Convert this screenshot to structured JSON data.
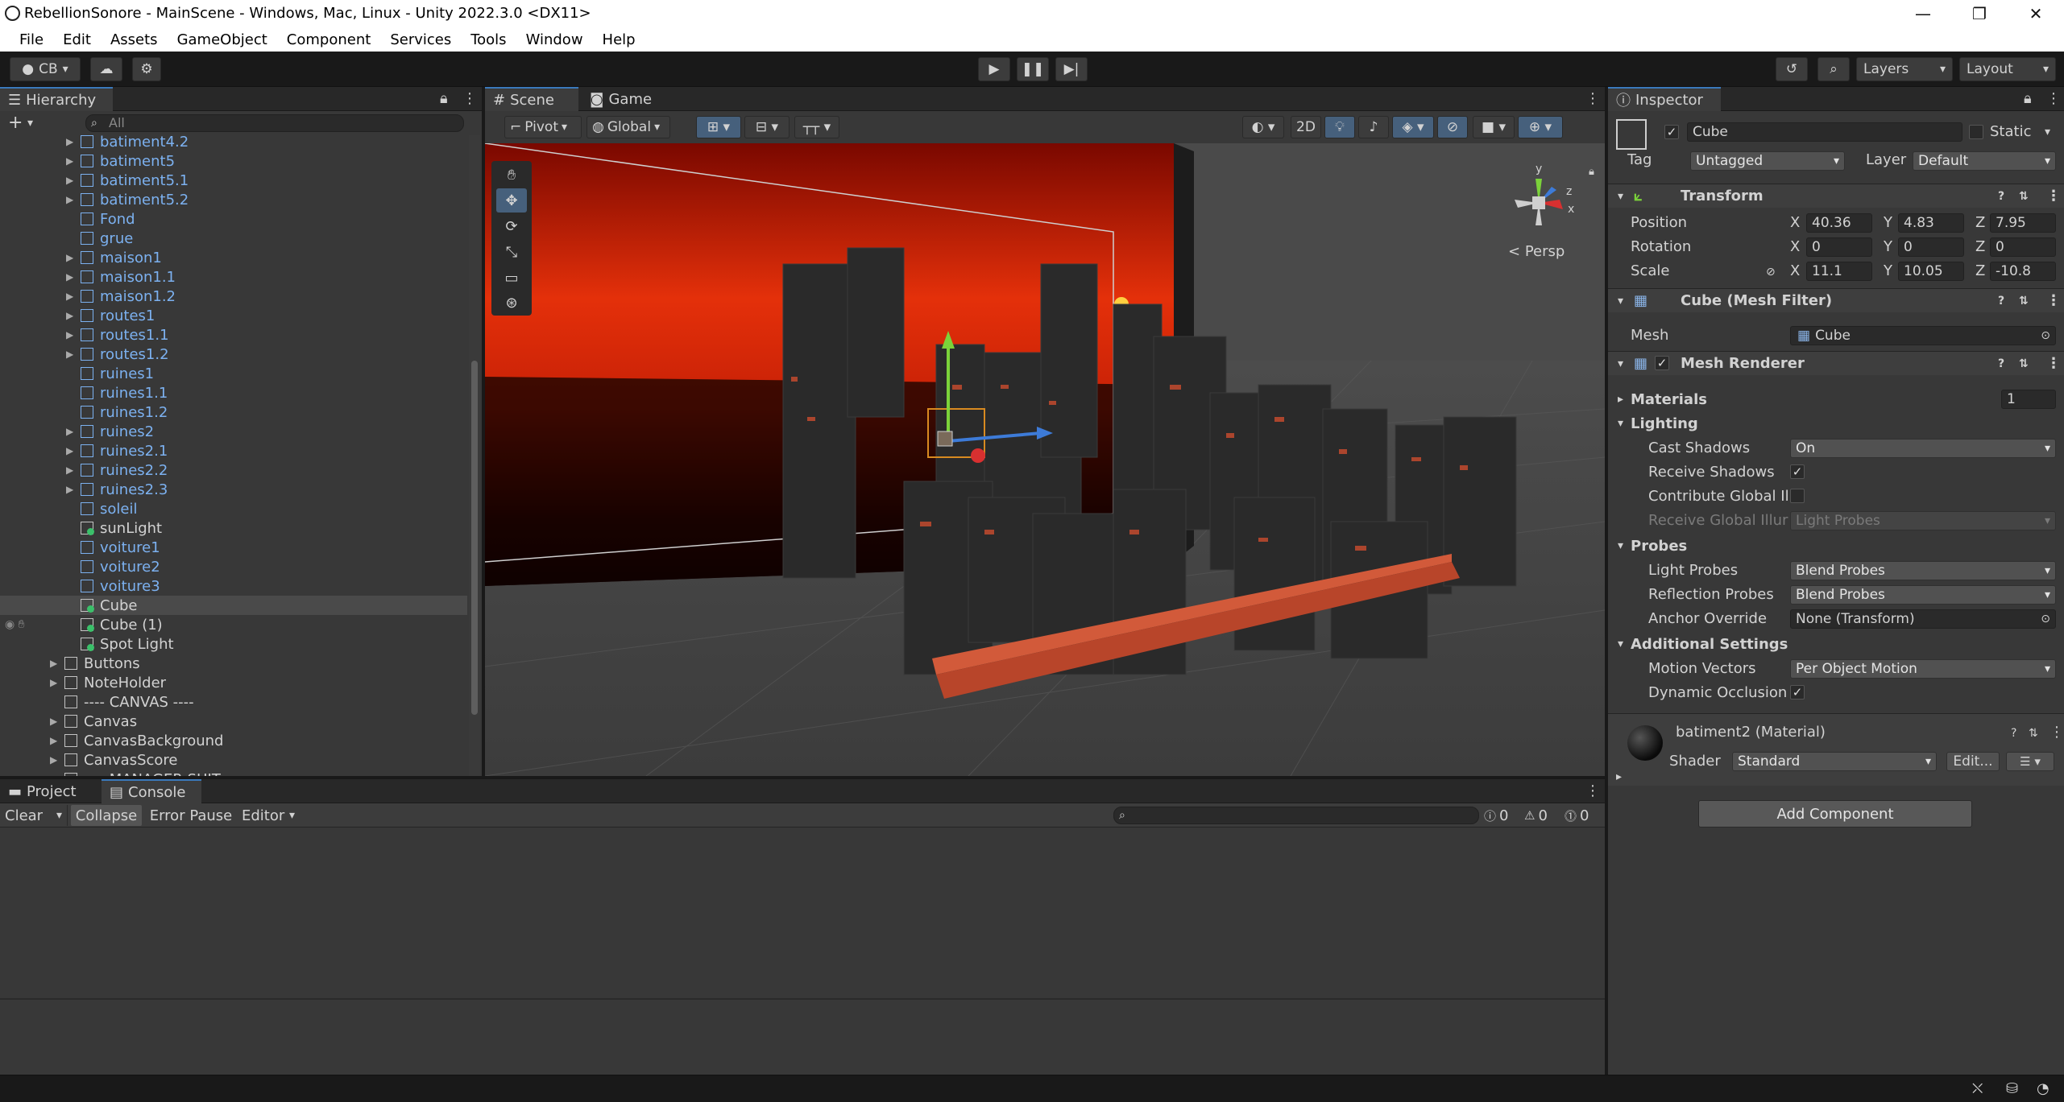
{
  "window": {
    "title": "RebellionSonore - MainScene - Windows, Mac, Linux - Unity 2022.3.0 <DX11>",
    "minimize": "—",
    "maximize": "❐",
    "close": "✕"
  },
  "menu": [
    "File",
    "Edit",
    "Assets",
    "GameObject",
    "Component",
    "Services",
    "Tools",
    "Window",
    "Help"
  ],
  "toolbar": {
    "account": "CB",
    "layers": "Layers",
    "layout": "Layout"
  },
  "hierarchy": {
    "tab": "Hierarchy",
    "search_placeholder": "All",
    "items": [
      {
        "label": "batiment4.2",
        "depth": 2,
        "arrow": true,
        "blue": true
      },
      {
        "label": "batiment5",
        "depth": 2,
        "arrow": true,
        "blue": true
      },
      {
        "label": "batiment5.1",
        "depth": 2,
        "arrow": true,
        "blue": true
      },
      {
        "label": "batiment5.2",
        "depth": 2,
        "arrow": true,
        "blue": true
      },
      {
        "label": "Fond",
        "depth": 2,
        "arrow": false,
        "blue": true
      },
      {
        "label": "grue",
        "depth": 2,
        "arrow": false,
        "blue": true
      },
      {
        "label": "maison1",
        "depth": 2,
        "arrow": true,
        "blue": true
      },
      {
        "label": "maison1.1",
        "depth": 2,
        "arrow": true,
        "blue": true
      },
      {
        "label": "maison1.2",
        "depth": 2,
        "arrow": true,
        "blue": true
      },
      {
        "label": "routes1",
        "depth": 2,
        "arrow": true,
        "blue": true
      },
      {
        "label": "routes1.1",
        "depth": 2,
        "arrow": true,
        "blue": true
      },
      {
        "label": "routes1.2",
        "depth": 2,
        "arrow": true,
        "blue": true
      },
      {
        "label": "ruines1",
        "depth": 2,
        "arrow": false,
        "blue": true
      },
      {
        "label": "ruines1.1",
        "depth": 2,
        "arrow": false,
        "blue": true
      },
      {
        "label": "ruines1.2",
        "depth": 2,
        "arrow": false,
        "blue": true
      },
      {
        "label": "ruines2",
        "depth": 2,
        "arrow": true,
        "blue": true
      },
      {
        "label": "ruines2.1",
        "depth": 2,
        "arrow": true,
        "blue": true
      },
      {
        "label": "ruines2.2",
        "depth": 2,
        "arrow": true,
        "blue": true
      },
      {
        "label": "ruines2.3",
        "depth": 2,
        "arrow": true,
        "blue": true
      },
      {
        "label": "soleil",
        "depth": 2,
        "arrow": false,
        "blue": true
      },
      {
        "label": "sunLight",
        "depth": 2,
        "arrow": false,
        "blue": false,
        "green": true
      },
      {
        "label": "voiture1",
        "depth": 2,
        "arrow": false,
        "blue": true
      },
      {
        "label": "voiture2",
        "depth": 2,
        "arrow": false,
        "blue": true
      },
      {
        "label": "voiture3",
        "depth": 2,
        "arrow": false,
        "blue": true
      },
      {
        "label": "Cube",
        "depth": 2,
        "arrow": false,
        "blue": false,
        "green": true,
        "selected": true
      },
      {
        "label": "Cube (1)",
        "depth": 2,
        "arrow": false,
        "blue": false,
        "green": true
      },
      {
        "label": "Spot Light",
        "depth": 2,
        "arrow": false,
        "blue": false,
        "green": true
      },
      {
        "label": "Buttons",
        "depth": 1,
        "arrow": true,
        "blue": false
      },
      {
        "label": "NoteHolder",
        "depth": 1,
        "arrow": true,
        "blue": false
      },
      {
        "label": "---- CANVAS ----",
        "depth": 1,
        "arrow": false,
        "blue": false
      },
      {
        "label": "Canvas",
        "depth": 1,
        "arrow": true,
        "blue": false
      },
      {
        "label": "CanvasBackground",
        "depth": 1,
        "arrow": true,
        "blue": false
      },
      {
        "label": "CanvasScore",
        "depth": 1,
        "arrow": true,
        "blue": false
      },
      {
        "label": "---- MANAGER SHIT ----",
        "depth": 1,
        "arrow": true,
        "blue": false
      }
    ]
  },
  "scene": {
    "tab_scene": "Scene",
    "tab_game": "Game",
    "pivot": "Pivot",
    "global": "Global",
    "mode_2d": "2D",
    "persp": "Persp",
    "axis_y": "y",
    "axis_z": "z",
    "axis_x": "x"
  },
  "console": {
    "tab_project": "Project",
    "tab_console": "Console",
    "clear": "Clear",
    "collapse": "Collapse",
    "error_pause": "Error Pause",
    "editor": "Editor",
    "count_log": "0",
    "count_warn": "0",
    "count_err": "0"
  },
  "inspector": {
    "tab": "Inspector",
    "object_name": "Cube",
    "static": "Static",
    "tag_label": "Tag",
    "tag_value": "Untagged",
    "layer_label": "Layer",
    "layer_value": "Default",
    "transform": {
      "title": "Transform",
      "position": "Position",
      "rotation": "Rotation",
      "scale": "Scale",
      "pos": {
        "x": "40.36",
        "y": "4.83",
        "z": "7.95"
      },
      "rot": {
        "x": "0",
        "y": "0",
        "z": "0"
      },
      "scl": {
        "x": "11.1",
        "y": "10.05",
        "z": "-10.8"
      },
      "X": "X",
      "Y": "Y",
      "Z": "Z"
    },
    "mesh_filter": {
      "title": "Cube (Mesh Filter)",
      "mesh_label": "Mesh",
      "mesh_value": "Cube"
    },
    "mesh_renderer": {
      "title": "Mesh Renderer",
      "materials": "Materials",
      "materials_count": "1",
      "lighting": "Lighting",
      "cast_shadows": "Cast Shadows",
      "cast_shadows_value": "On",
      "receive_shadows": "Receive Shadows",
      "contribute_gi": "Contribute Global Ill",
      "receive_gi": "Receive Global Illur",
      "receive_gi_value": "Light Probes",
      "probes": "Probes",
      "light_probes": "Light Probes",
      "light_probes_value": "Blend Probes",
      "reflection_probes": "Reflection Probes",
      "reflection_probes_value": "Blend Probes",
      "anchor_override": "Anchor Override",
      "anchor_override_value": "None (Transform)",
      "additional": "Additional Settings",
      "motion_vectors": "Motion Vectors",
      "motion_vectors_value": "Per Object Motion",
      "dynamic_occlusion": "Dynamic Occlusion"
    },
    "material": {
      "name": "batiment2 (Material)",
      "shader_label": "Shader",
      "shader_value": "Standard",
      "edit": "Edit..."
    },
    "add_component": "Add Component"
  }
}
